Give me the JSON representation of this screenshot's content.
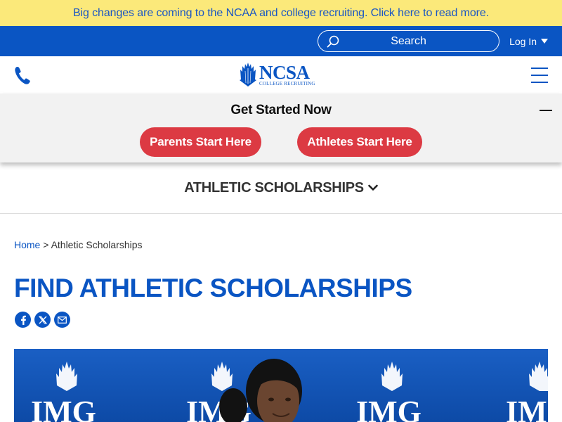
{
  "announcement": {
    "text": "Big changes are coming to the NCAA and college recruiting. Click here to read more."
  },
  "topbar": {
    "search_placeholder": "Search",
    "login_label": "Log In"
  },
  "logo": {
    "name": "NCSA",
    "sub": "COLLEGE RECRUITING"
  },
  "get_started": {
    "title": "Get Started Now",
    "parents_label": "Parents Start Here",
    "athletes_label": "Athletes Start Here"
  },
  "section_nav": {
    "label": "ATHLETIC SCHOLARSHIPS"
  },
  "breadcrumb": {
    "home": "Home",
    "separator": ">",
    "current": "Athletic Scholarships"
  },
  "page": {
    "title": "FIND ATHLETIC SCHOLARSHIPS"
  },
  "share": [
    "facebook-icon",
    "x-icon",
    "email-icon"
  ],
  "hero": {
    "backdrop_text": "IMG"
  },
  "colors": {
    "brand_blue": "#0a55c3",
    "announce_yellow": "#fbe97a",
    "cta_red": "#dc3a43",
    "panel_gray": "#f2f2f2"
  }
}
